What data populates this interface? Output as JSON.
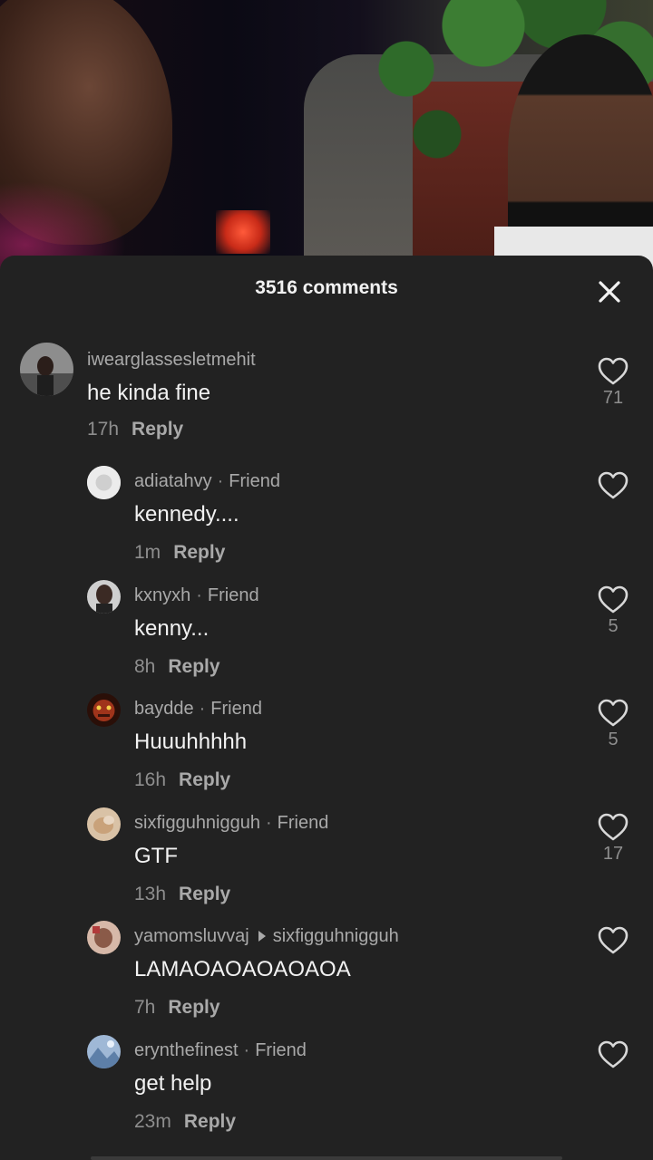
{
  "sheet": {
    "title": "3516 comments"
  },
  "comments": [
    {
      "username": "iwearglassesletmehit",
      "friend": "",
      "reply_to": "",
      "text": "he kinda fine",
      "time": "17h",
      "reply_label": "Reply",
      "likes": "71",
      "avatar_color": "#9a9a9a"
    },
    {
      "username": "adiatahvy",
      "friend": "Friend",
      "reply_to": "",
      "text": "kennedy....",
      "time": "1m",
      "reply_label": "Reply",
      "likes": "",
      "avatar_color": "#d9d9d9"
    },
    {
      "username": "kxnyxh",
      "friend": "Friend",
      "reply_to": "",
      "text": "kenny...",
      "time": "8h",
      "reply_label": "Reply",
      "likes": "5",
      "avatar_color": "#3b2a24"
    },
    {
      "username": "baydde",
      "friend": "Friend",
      "reply_to": "",
      "text": "Huuuhhhhh",
      "time": "16h",
      "reply_label": "Reply",
      "likes": "5",
      "avatar_color": "#a0341b"
    },
    {
      "username": "sixfigguhnigguh",
      "friend": "Friend",
      "reply_to": "",
      "text": "GTF",
      "time": "13h",
      "reply_label": "Reply",
      "likes": "17",
      "avatar_color": "#c9a27a"
    },
    {
      "username": "yamomsluvvaj",
      "friend": "",
      "reply_to": "sixfigguhnigguh",
      "text": "LAMAOAOAOAOAOA",
      "time": "7h",
      "reply_label": "Reply",
      "likes": "",
      "avatar_color": "#8a5a48"
    },
    {
      "username": "erynthefinest",
      "friend": "Friend",
      "reply_to": "",
      "text": "get help",
      "time": "23m",
      "reply_label": "Reply",
      "likes": "",
      "avatar_color": "#6f8fb5"
    }
  ],
  "icons": {
    "close": "close-icon",
    "like": "heart-outline-icon"
  },
  "colors": {
    "sheet_background": "#222222",
    "primary_text": "#f2f2f2",
    "secondary_text": "#a9a9a9"
  }
}
